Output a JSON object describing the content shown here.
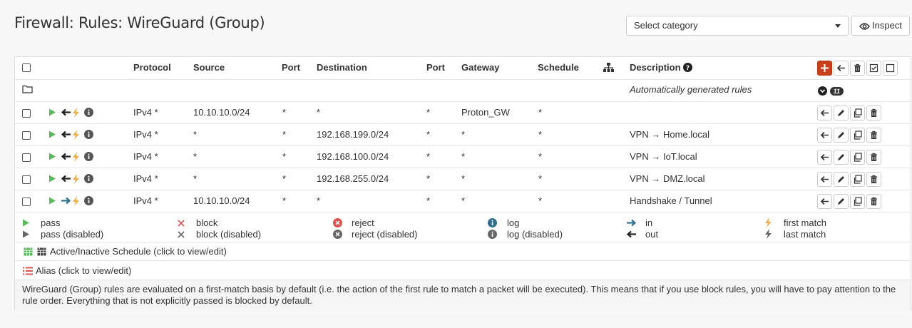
{
  "header": {
    "title": "Firewall: Rules: WireGuard (Group)",
    "category_placeholder": "Select category",
    "inspect_label": "Inspect"
  },
  "table": {
    "columns": {
      "protocol": "Protocol",
      "source": "Source",
      "src_port": "Port",
      "destination": "Destination",
      "dst_port": "Port",
      "gateway": "Gateway",
      "schedule": "Schedule",
      "description": "Description"
    },
    "auto_rules": {
      "label": "Automatically generated rules",
      "count": "11"
    },
    "rules": [
      {
        "protocol": "IPv4 *",
        "source": "10.10.10.0/24",
        "src_port": "*",
        "destination": "*",
        "dst_port": "*",
        "gateway": "Proton_GW",
        "schedule": "*",
        "description": "",
        "direction": "out"
      },
      {
        "protocol": "IPv4 *",
        "source": "*",
        "src_port": "*",
        "destination": "192.168.199.0/24",
        "dst_port": "*",
        "gateway": "*",
        "schedule": "*",
        "description": "VPN → Home.local",
        "direction": "out"
      },
      {
        "protocol": "IPv4 *",
        "source": "*",
        "src_port": "*",
        "destination": "192.168.100.0/24",
        "dst_port": "*",
        "gateway": "*",
        "schedule": "*",
        "description": "VPN → IoT.local",
        "direction": "out"
      },
      {
        "protocol": "IPv4 *",
        "source": "*",
        "src_port": "*",
        "destination": "192.168.255.0/24",
        "dst_port": "*",
        "gateway": "*",
        "schedule": "*",
        "description": "VPN → DMZ.local",
        "direction": "out"
      },
      {
        "protocol": "IPv4 *",
        "source": "10.10.10.0/24",
        "src_port": "*",
        "destination": "*",
        "dst_port": "*",
        "gateway": "*",
        "schedule": "*",
        "description": "Handshake / Tunnel",
        "direction": "in"
      }
    ]
  },
  "legend": {
    "pass": "pass",
    "pass_disabled": "pass (disabled)",
    "block": "block",
    "block_disabled": "block (disabled)",
    "reject": "reject",
    "reject_disabled": "reject (disabled)",
    "log": "log",
    "log_disabled": "log (disabled)",
    "in": "in",
    "out": "out",
    "first_match": "first match",
    "last_match": "last match",
    "schedule": "Active/Inactive Schedule (click to view/edit)",
    "alias": "Alias (click to view/edit)"
  },
  "note": "WireGuard (Group) rules are evaluated on a first-match basis by default (i.e. the action of the first rule to match a packet will be executed). This means that if you use block rules, you will have to pay attention to the rule order. Everything that is not explicitly passed is blocked by default.",
  "colors": {
    "pass": "#5cb85c",
    "add_button": "#c9401d",
    "first_match": "#f0ad4e",
    "reject": "#d9534f",
    "log": "#31708f",
    "in_arrow": "#31708f"
  }
}
